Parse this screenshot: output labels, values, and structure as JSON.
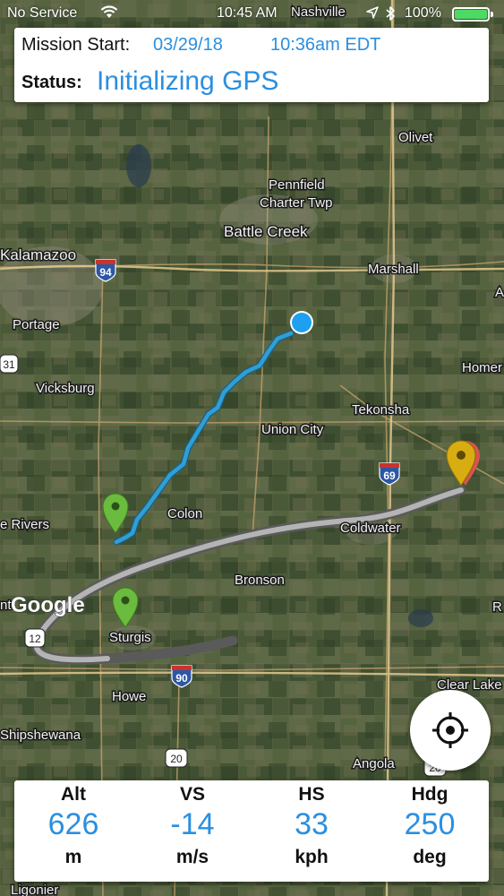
{
  "status_bar": {
    "carrier": "No Service",
    "time": "10:45 AM",
    "battery_percent": "100%",
    "battery_level": 1.0,
    "icons": [
      "wifi-icon",
      "location-arrow-icon",
      "bluetooth-icon",
      "battery-icon"
    ]
  },
  "mission": {
    "start_label": "Mission Start:",
    "start_date": "03/29/18",
    "start_time": "10:36am EDT",
    "status_label": "Status:",
    "status_value": "Initializing GPS"
  },
  "map": {
    "places": {
      "nashville": "Nashville",
      "olivet": "Olivet",
      "pennfield": "Pennfield",
      "charter_twp": "Charter Twp",
      "battle_creek": "Battle Creek",
      "kalamazoo": "Kalamazoo",
      "marshall": "Marshall",
      "portage": "Portage",
      "a_edge": "A",
      "homer": "Homer",
      "vicksburg": "Vicksburg",
      "tekonsha": "Tekonsha",
      "union_city": "Union City",
      "colon": "Colon",
      "three_rivers": "e Rivers",
      "coldwater": "Coldwater",
      "bronson": "Bronson",
      "r_edge": "R",
      "sturgis": "Sturgis",
      "ent_edge": "nt",
      "howe": "Howe",
      "clear_lake": "Clear Lake",
      "shipshewana": "Shipshewana",
      "angola": "Angola",
      "ligonier": "Ligonier"
    },
    "shields": {
      "i94": "94",
      "i69": "69",
      "i90": "90",
      "us31": "31",
      "us12": "12",
      "us20": "20",
      "us20b": "20"
    },
    "google_logo": "Google",
    "colors": {
      "flight_path": "#2f9fd4",
      "planned_route": "#b4b4b4",
      "start_marker": "#6bbb3f",
      "end_marker": "#d8ad12",
      "current_position": "#1ea0f0"
    }
  },
  "recenter_button": {
    "icon": "crosshair-icon"
  },
  "telemetry": [
    {
      "label": "Alt",
      "value": "626",
      "unit": "m"
    },
    {
      "label": "VS",
      "value": "-14",
      "unit": "m/s"
    },
    {
      "label": "HS",
      "value": "33",
      "unit": "kph"
    },
    {
      "label": "Hdg",
      "value": "250",
      "unit": "deg"
    }
  ],
  "accent_color": "#2b8fe0"
}
